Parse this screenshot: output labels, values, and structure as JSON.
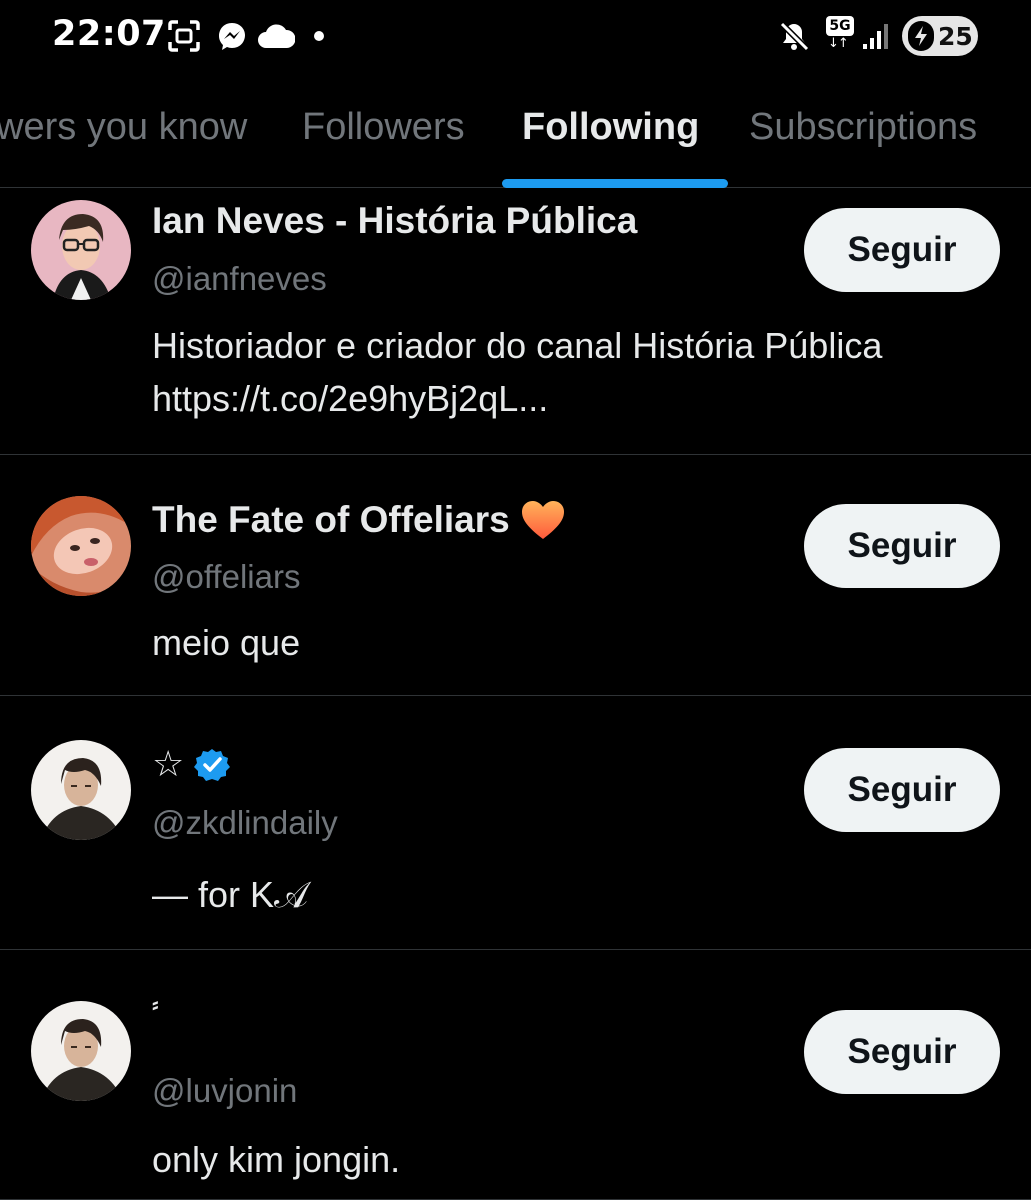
{
  "status_bar": {
    "time": "22:07",
    "network": "5G",
    "network_arrows": "↓↑",
    "battery_level": "25",
    "icons": [
      "screenshot-icon",
      "messenger-icon",
      "cloud-icon",
      "dot-icon",
      "mute-icon",
      "network-5g-icon",
      "signal-icon",
      "battery-charging-icon"
    ]
  },
  "tabs": [
    {
      "label": "wers you know",
      "active": false
    },
    {
      "label": "Followers",
      "active": false
    },
    {
      "label": "Following",
      "active": true
    },
    {
      "label": "Subscriptions",
      "active": false
    }
  ],
  "accent_color": "#1d9bf0",
  "users": [
    {
      "name": "Ian Neves - História Pública",
      "handle": "@ianfneves",
      "bio_lines": [
        "Historiador e criador do canal História Pública",
        "https://t.co/2e9hyBj2qL..."
      ],
      "button": "Seguir"
    },
    {
      "name": "The Fate of Offeliars",
      "name_emoji": "orange-heart-icon",
      "handle": "@offeliars",
      "bio_lines": [
        "meio que"
      ],
      "button": "Seguir"
    },
    {
      "name": "☆",
      "verified": true,
      "handle": "@zkdlindaily",
      "bio_lines": [
        "— for K𝒜"
      ],
      "button": "Seguir"
    },
    {
      "name": "⸗",
      "handle": "@luvjonin",
      "bio_lines": [
        "only kim jongin."
      ],
      "button": "Seguir"
    }
  ]
}
